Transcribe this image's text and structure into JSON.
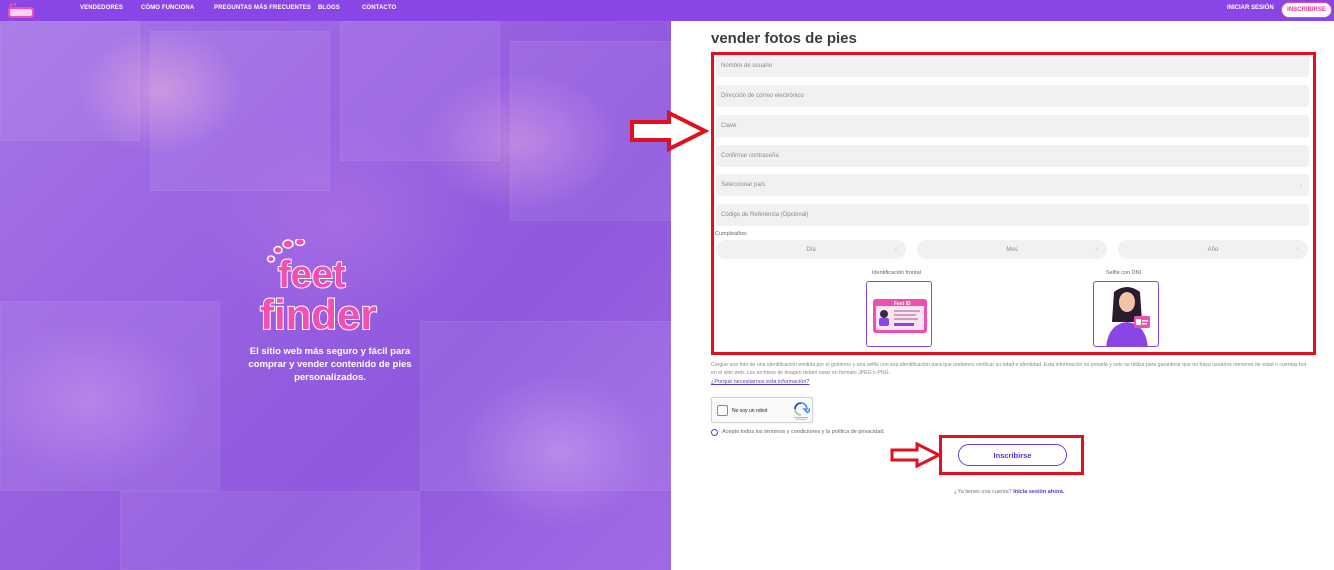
{
  "nav": {
    "logo_icon": "feet-finder-logo-icon",
    "links": [
      "VENDEDORES",
      "CÓMO FUNCIONA",
      "PREGUNTAS MÁS FRECUENTES",
      "BLOGS",
      "CONTACTO"
    ],
    "login": "INICIAR SESIÓN",
    "signup": "INSCRIBIRSE"
  },
  "hero": {
    "logo_text_1": "feet",
    "logo_text_2": "finder",
    "tagline": "El sitio web más seguro y fácil para comprar y vender contenido de pies personalizados."
  },
  "form": {
    "title": "vender fotos de pies",
    "username_placeholder": "Nombre de usuario",
    "email_placeholder": "Dirección de correo electrónico",
    "password_placeholder": "Clave",
    "confirm_placeholder": "Confirmar contraseña",
    "country_placeholder": "Seleccionar país",
    "referral_placeholder": "Código de Referencia (Opcional)",
    "birthday_label": "Cumpleaños:",
    "day": "Día",
    "month": "Mes",
    "year": "Año",
    "id_front_label": "Identificación frontal",
    "selfie_label": "Selfie con DNI",
    "id_card_title": "Feet ID",
    "info_text": "Cargue una foto de una identificación emitida por el gobierno y una selfie con esa identificación para que podamos verificar su edad e identidad. Esta información es privada y solo se utiliza para garantizar que no haya usuarios menores de edad o cuentas bot en el sitio web. Los archivos de imagen deben estar en formato JPEG o PNG.",
    "info_link": "¿Porqué necesitamos esta información?",
    "captcha_text": "No soy un robot",
    "terms": "Acepto todos los términos y condiciones y la política de privacidad.",
    "submit": "Inscribirse",
    "have_account": "¿Ya tienes una cuenta?",
    "login_now": "Inicia sesión ahora."
  },
  "colors": {
    "brand_purple": "#8a45e6",
    "brand_pink": "#e8338f",
    "annotation_red": "#e0101e"
  }
}
